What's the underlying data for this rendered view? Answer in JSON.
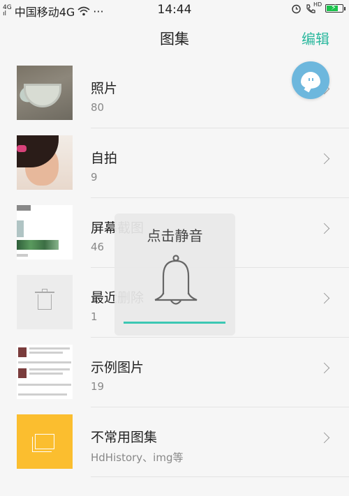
{
  "status_bar": {
    "signal_top": "4G",
    "signal_bottom": "ıl",
    "carrier": "中国移动4G",
    "wifi_icon": "wifi-icon",
    "more": "···",
    "time": "14:44",
    "alarm_icon": "alarm-icon",
    "hd_label": "HD",
    "battery_level_percent": 75,
    "battery_color": "#19c24b"
  },
  "header": {
    "title": "图集",
    "edit_label": "编辑",
    "accent_color": "#2bb89e"
  },
  "albums": [
    {
      "name": "照片",
      "count": "80"
    },
    {
      "name": "自拍",
      "count": "9"
    },
    {
      "name": "屏幕截图",
      "count": "46"
    },
    {
      "name": "最近删除",
      "count": "1"
    },
    {
      "name": "示例图片",
      "count": "19"
    },
    {
      "name": "不常用图集",
      "count": "HdHistory、img等"
    }
  ],
  "toast": {
    "title": "点击静音",
    "icon": "bell-icon",
    "bar_color": "#3cc7b3"
  },
  "floating_button": {
    "icon": "assistant-bubble-icon",
    "color": "#6db7dd"
  }
}
